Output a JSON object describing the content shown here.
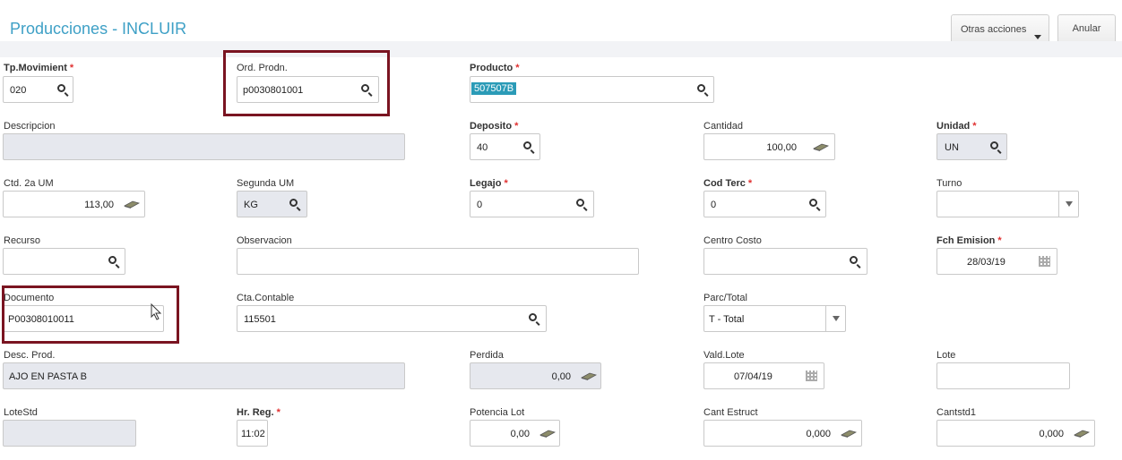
{
  "header": {
    "title": "Producciones - INCLUIR",
    "other_actions": "Otras acciones",
    "cancel": "Anular"
  },
  "fields": {
    "tp_movimiento": {
      "label": "Tp.Movimient",
      "value": "020"
    },
    "ord_prodn": {
      "label": "Ord. Prodn.",
      "value": "p0030801001"
    },
    "producto": {
      "label": "Producto",
      "value": "507507B"
    },
    "descripcion": {
      "label": "Descripcion",
      "value": ""
    },
    "deposito": {
      "label": "Deposito",
      "value": "40"
    },
    "cantidad": {
      "label": "Cantidad",
      "value": "100,00"
    },
    "unidad": {
      "label": "Unidad",
      "value": "UN"
    },
    "ctd_2a_um": {
      "label": "Ctd. 2a UM",
      "value": "113,00"
    },
    "segunda_um": {
      "label": "Segunda UM",
      "value": "KG"
    },
    "legajo": {
      "label": "Legajo",
      "value": "0"
    },
    "cod_terc": {
      "label": "Cod Terc",
      "value": "0"
    },
    "turno": {
      "label": "Turno",
      "value": ""
    },
    "recurso": {
      "label": "Recurso",
      "value": ""
    },
    "observacion": {
      "label": "Observacion",
      "value": ""
    },
    "centro_costo": {
      "label": "Centro Costo",
      "value": ""
    },
    "fch_emision": {
      "label": "Fch Emision",
      "value": "28/03/19"
    },
    "documento": {
      "label": "Documento",
      "value": "P00308010011"
    },
    "cta_contable": {
      "label": "Cta.Contable",
      "value": "115501"
    },
    "parc_total": {
      "label": "Parc/Total",
      "value": "T - Total"
    },
    "desc_prod": {
      "label": "Desc. Prod.",
      "value": "AJO EN PASTA B"
    },
    "perdida": {
      "label": "Perdida",
      "value": "0,00"
    },
    "vald_lote": {
      "label": "Vald.Lote",
      "value": "07/04/19"
    },
    "lote": {
      "label": "Lote",
      "value": ""
    },
    "lote_std": {
      "label": "LoteStd",
      "value": ""
    },
    "hr_reg": {
      "label": "Hr. Reg.",
      "value": "11:02"
    },
    "potencia_lot": {
      "label": "Potencia Lot",
      "value": "0,00"
    },
    "cant_estruct": {
      "label": "Cant Estruct",
      "value": "0,000"
    },
    "cantstd1": {
      "label": "Cantstd1",
      "value": "0,000"
    }
  },
  "required_mark": "*",
  "colors": {
    "title": "#3ea0c6",
    "highlight": "#7a1421",
    "selection": "#2b9bb7",
    "required": "#e03030"
  }
}
